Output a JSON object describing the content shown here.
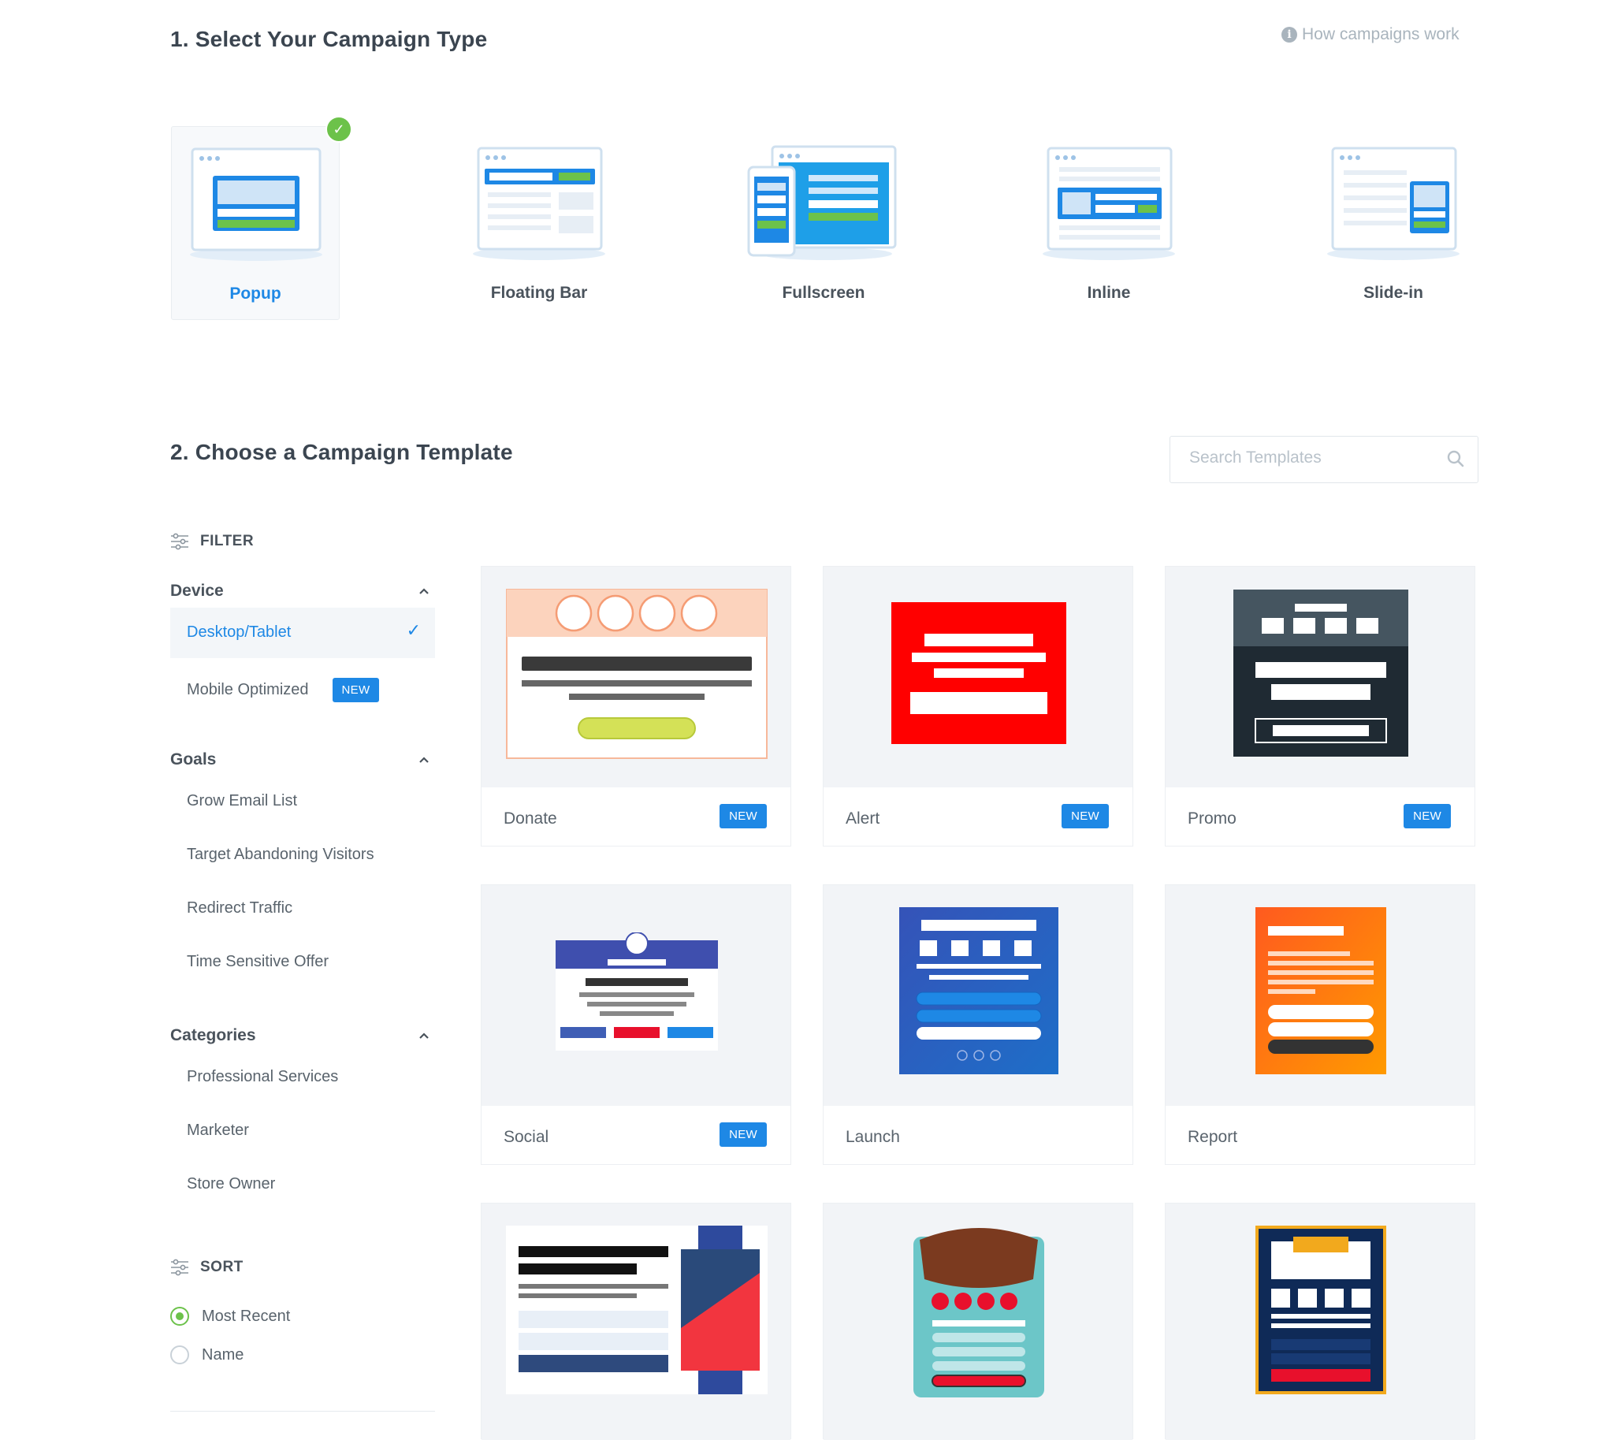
{
  "step1": {
    "title": "1. Select Your Campaign Type",
    "help_link": "How campaigns work",
    "types": [
      {
        "label": "Popup",
        "selected": true
      },
      {
        "label": "Floating Bar",
        "selected": false
      },
      {
        "label": "Fullscreen",
        "selected": false
      },
      {
        "label": "Inline",
        "selected": false
      },
      {
        "label": "Slide-in",
        "selected": false
      }
    ]
  },
  "step2": {
    "title": "2. Choose a Campaign Template",
    "search_placeholder": "Search Templates"
  },
  "filter": {
    "heading": "FILTER",
    "device": {
      "title": "Device",
      "options": [
        {
          "label": "Desktop/Tablet",
          "selected": true
        },
        {
          "label": "Mobile Optimized",
          "badge": "NEW"
        }
      ]
    },
    "goals": {
      "title": "Goals",
      "options": [
        "Grow Email List",
        "Target Abandoning Visitors",
        "Redirect Traffic",
        "Time Sensitive Offer"
      ]
    },
    "categories": {
      "title": "Categories",
      "options": [
        "Professional Services",
        "Marketer",
        "Store Owner"
      ]
    }
  },
  "sort": {
    "heading": "SORT",
    "options": [
      {
        "label": "Most Recent",
        "selected": true
      },
      {
        "label": "Name",
        "selected": false
      }
    ]
  },
  "templates": [
    {
      "name": "Donate",
      "badge": "NEW"
    },
    {
      "name": "Alert",
      "badge": "NEW"
    },
    {
      "name": "Promo",
      "badge": "NEW"
    },
    {
      "name": "Social",
      "badge": "NEW"
    },
    {
      "name": "Launch",
      "badge": ""
    },
    {
      "name": "Report",
      "badge": ""
    }
  ],
  "colors": {
    "accent_blue": "#1e88e5",
    "success_green": "#6cc24a",
    "heading_text": "#3b4550"
  }
}
